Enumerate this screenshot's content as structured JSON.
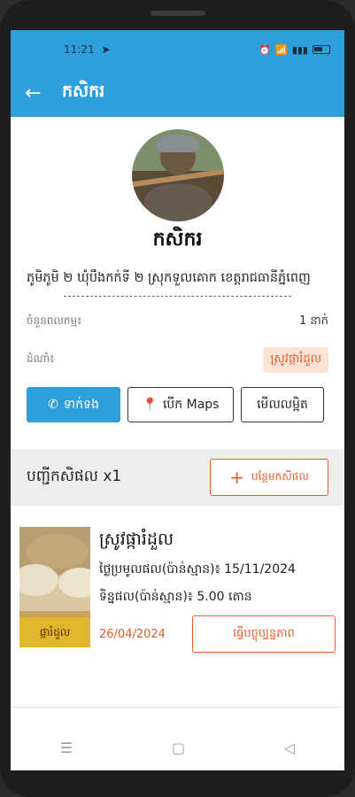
{
  "status": {
    "time": "11:21",
    "icons": [
      "telegram-icon",
      "wifi-icon",
      "signal-icon",
      "battery-icon"
    ]
  },
  "appbar": {
    "title": "កសិករ"
  },
  "profile": {
    "name": "កសិករ"
  },
  "address": "ភូមិភូមិ ២ ឃុំបឹងកក់ទី ២ ស្រុកទួលគោក ខេត្តរាជធានីភ្នំពេញ",
  "info": {
    "members_label": "ចំនួនពលកម្ម៖",
    "members_value": "1 នាក់",
    "crops_label": "ដំណាំ៖",
    "crops_value": "ស្រូវផ្ការំដួល"
  },
  "actions": {
    "call": "ទាក់ទង",
    "maps": "បើក Maps",
    "detail": "មើលលម្អិត"
  },
  "section": {
    "title": "បញ្ជីកសិផល x1",
    "add": "បន្ថែមកសិផល"
  },
  "product": {
    "thumb_label": "ផ្ការំដួល",
    "title": "ស្រូវផ្ការំដួល",
    "harvest": "ថ្ងៃប្រមូលផល(ប៉ាន់ស្មាន)៖ 15/11/2024",
    "yield": "ទិន្នផល(ប៉ាន់ស្មាន)៖ 5.00 តោន",
    "date": "26/04/2024",
    "edit": "ធ្វើបច្ចុប្បន្នភាព"
  },
  "colors": {
    "primary": "#2f9fdc",
    "accent": "#e25c2c",
    "badge_bg": "#fde3d7"
  }
}
